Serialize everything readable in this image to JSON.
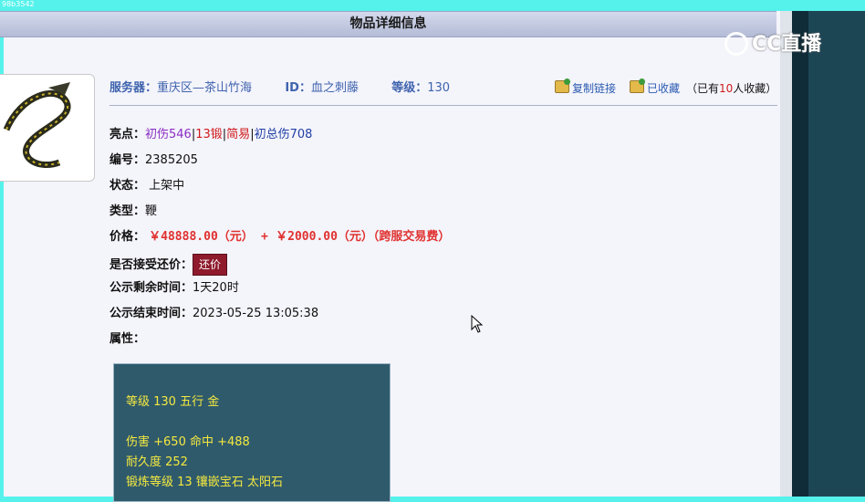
{
  "top_tiny_text": "98b3542",
  "window_title": "物品详细信息",
  "logo": {
    "text": "CC直播"
  },
  "header": {
    "server_label": "服务器：",
    "server_value": "重庆区—茶山竹海",
    "id_label": "ID：",
    "id_value": "血之刺藤",
    "level_label": "等级：",
    "level_value": "130",
    "copy_link": "复制链接",
    "favorited": "已收藏",
    "fav_prefix": "（已有",
    "fav_count": "10",
    "fav_suffix": "人收藏）"
  },
  "highlights": {
    "label": "亮点：",
    "item1": "初伤546",
    "sep": "|",
    "item2": "13锻",
    "item3": "简易",
    "item4": "初总伤708"
  },
  "number": {
    "label": "编号：",
    "value": "2385205"
  },
  "status": {
    "label": "状态：",
    "value": "上架中"
  },
  "type": {
    "label": "类型：",
    "value": "鞭"
  },
  "price": {
    "label": "价格：",
    "main": "￥48888.00（元）",
    "plus": "+",
    "fee": "￥2000.00（元）（跨服交易费）"
  },
  "counter_offer": {
    "label": "是否接受还价：",
    "button": "还价"
  },
  "remaining": {
    "label": "公示剩余时间：",
    "value": "1天20时"
  },
  "end_time": {
    "label": "公示结束时间：",
    "value": "2023-05-25 13:05:38"
  },
  "attributes": {
    "label": "属性：",
    "lines": [
      "等级 130 五行 金",
      "伤害 +650 命中 +488",
      "耐久度 252",
      "锻炼等级 13 镶嵌宝石 太阳石"
    ]
  },
  "colors": {
    "accent_link": "#3f63ad",
    "price": "#e0312f",
    "attr_bg": "#2f5a6c",
    "attr_text": "#f4e93f",
    "button": "#8e1a2c"
  }
}
